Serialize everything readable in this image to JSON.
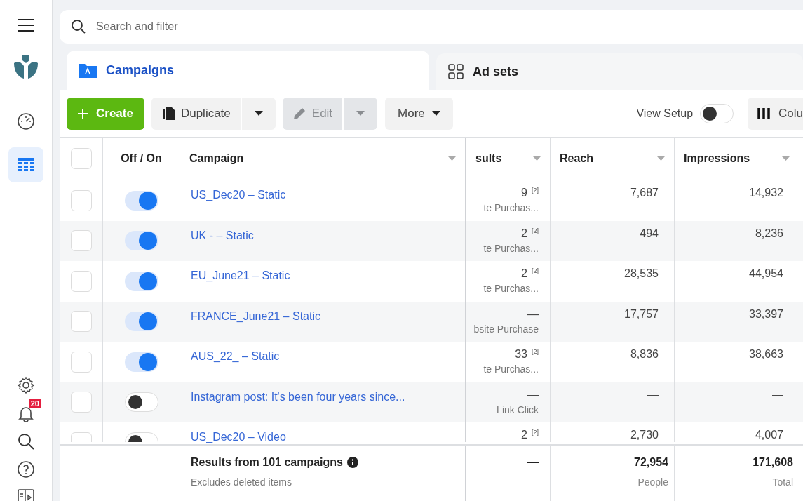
{
  "sidebar": {
    "items": [
      {
        "kind": "gauge",
        "selected": false
      },
      {
        "kind": "table",
        "selected": true
      }
    ],
    "bottom_items": [
      {
        "kind": "settings"
      },
      {
        "kind": "notifications",
        "badge": "20"
      },
      {
        "kind": "search"
      },
      {
        "kind": "help"
      },
      {
        "kind": "panel"
      }
    ]
  },
  "search": {
    "placeholder": "Search and filter"
  },
  "tabs": [
    {
      "label": "Campaigns",
      "kind": "campaigns",
      "selected": true
    },
    {
      "label": "Ad sets",
      "kind": "adsets",
      "selected": false
    }
  ],
  "toolbar": {
    "create": "Create",
    "duplicate": "Duplicate",
    "edit": {
      "label": "Edit",
      "disabled": true
    },
    "more": "More",
    "view_setup": {
      "label": "View Setup",
      "on": false
    },
    "columns": "Colu"
  },
  "table": {
    "select_all_checked": false,
    "columns": [
      "Off / On",
      "Campaign",
      "sults",
      "Reach",
      "Impressions"
    ],
    "rows": [
      {
        "checked": false,
        "on": true,
        "campaign": "US_Dec20 – Static",
        "results": "9",
        "note": "[2]",
        "results_sub": "te Purchas...",
        "reach": "7,687",
        "impressions": "14,932"
      },
      {
        "checked": false,
        "on": true,
        "campaign": "UK - – Static",
        "results": "2",
        "note": "[2]",
        "results_sub": "te Purchas...",
        "reach": "494",
        "impressions": "8,236"
      },
      {
        "checked": false,
        "on": true,
        "campaign": "EU_June21 – Static",
        "results": "2",
        "note": "[2]",
        "results_sub": "te Purchas...",
        "reach": "28,535",
        "impressions": "44,954"
      },
      {
        "checked": false,
        "on": true,
        "campaign": "FRANCE_June21 – Static",
        "results": "—",
        "results_sub": "bsite Purchase",
        "reach": "17,757",
        "impressions": "33,397"
      },
      {
        "checked": false,
        "on": true,
        "campaign": "AUS_22_ – Static",
        "results": "33",
        "note": "[2]",
        "results_sub": "te Purchas...",
        "reach": "8,836",
        "impressions": "38,663"
      },
      {
        "checked": false,
        "on": false,
        "campaign": "Instagram post: It's been four years since...",
        "results": "—",
        "results_sub": "Link Click",
        "reach": "—",
        "impressions": "—"
      },
      {
        "checked": false,
        "on": false,
        "campaign": "US_Dec20 – Video",
        "results": "2",
        "note": "[2]",
        "reach": "2,730",
        "impressions": "4,007"
      }
    ],
    "footer": {
      "title": "Results from 101 campaigns",
      "subtitle": "Excludes deleted items",
      "results": "—",
      "reach": "72,954",
      "reach_sub": "People",
      "impressions": "171,608",
      "impressions_sub": "Total"
    }
  }
}
